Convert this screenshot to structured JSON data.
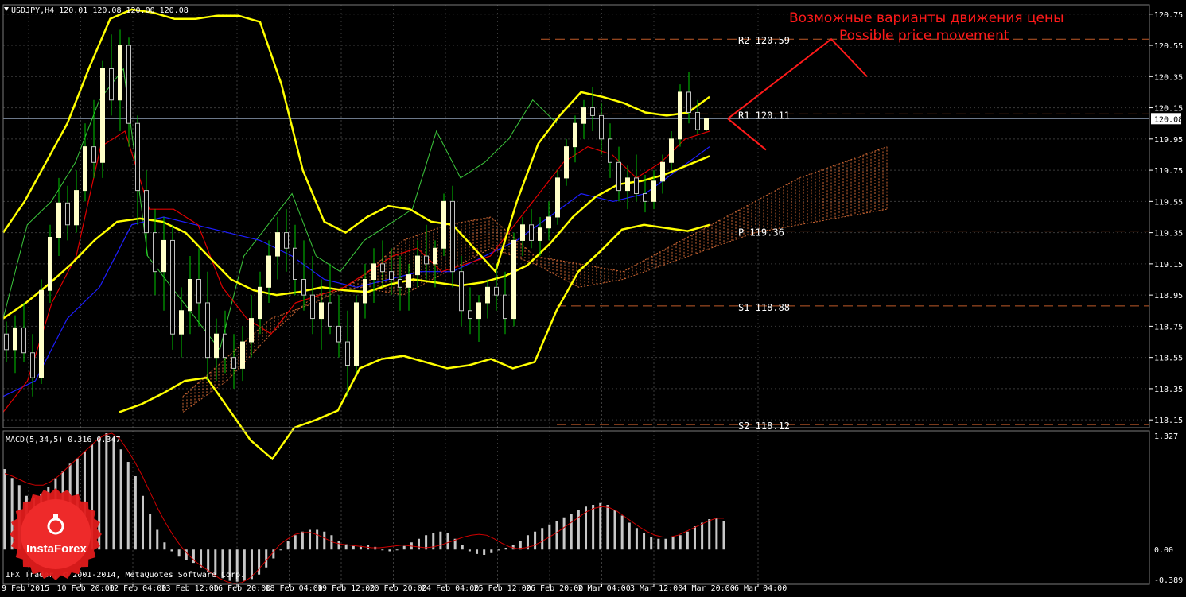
{
  "window": {
    "symbol_header": "USDJPY,H4  120.01 120.08 120.00 120.08",
    "copyright": "IFX Trader, © 2001-2014, MetaQuotes Software Corp."
  },
  "colors": {
    "background": "#000000",
    "grid": "#3a3a3a",
    "bollinger": "#ffff00",
    "candle_up": "#ffffc8",
    "candle_down": "#c0c0c0",
    "wick": "#00c800",
    "chikou": "#3cc83c",
    "tenkan": "#e00000",
    "kijun": "#1e1eff",
    "kumo": "#cc6633",
    "pivot": "#c05a28",
    "forecast": "#ff1a1a",
    "histogram": "#c8c8c8",
    "macd_signal": "#d00000",
    "axis_text": "#ffffff"
  },
  "annotation": {
    "title_ru": "Возможные варианты движения цены",
    "title_en": "Possible price movement"
  },
  "brand": {
    "name": "InstaForex"
  },
  "chart_data": [
    {
      "type": "candlestick",
      "symbol": "USDJPY",
      "timeframe": "H4",
      "header_ohlc": {
        "open": 120.01,
        "high": 120.08,
        "low": 120.0,
        "close": 120.08
      },
      "current_price": "120.08",
      "y_range": [
        118.1,
        120.81
      ],
      "y_tick_labels": [
        "120.75",
        "120.55",
        "120.35",
        "120.15",
        "119.95",
        "119.75",
        "119.55",
        "119.35",
        "119.15",
        "118.95",
        "118.75",
        "118.55",
        "118.35",
        "118.15"
      ],
      "x_tick_labels": [
        "9 Feb 2015",
        "10 Feb 20:00",
        "12 Feb 04:00",
        "13 Feb 12:00",
        "16 Feb 20:00",
        "18 Feb 04:00",
        "19 Feb 12:00",
        "20 Feb 20:00",
        "24 Feb 04:00",
        "25 Feb 12:00",
        "26 Feb 20:00",
        "2 Mar 04:00",
        "3 Mar 12:00",
        "4 Mar 20:00",
        "6 Mar 04:00"
      ],
      "pivot_levels": [
        {
          "name": "R2",
          "label": "R2 120.59",
          "value": 120.59
        },
        {
          "name": "R1",
          "label": "R1 120.11",
          "value": 120.11
        },
        {
          "name": "P",
          "label": "P 119.36",
          "value": 119.36
        },
        {
          "name": "S1",
          "label": "S1 118.88",
          "value": 118.88
        },
        {
          "name": "S2",
          "label": "S2 118.12",
          "value": 118.12
        }
      ],
      "candles": [
        [
          118.7,
          118.78,
          118.52,
          118.6
        ],
        [
          118.6,
          118.82,
          118.45,
          118.74
        ],
        [
          118.74,
          118.9,
          118.52,
          118.58
        ],
        [
          118.58,
          118.7,
          118.3,
          118.42
        ],
        [
          118.42,
          119.05,
          118.38,
          118.98
        ],
        [
          118.98,
          119.4,
          118.9,
          119.32
        ],
        [
          119.32,
          119.7,
          119.2,
          119.54
        ],
        [
          119.54,
          119.65,
          119.3,
          119.4
        ],
        [
          119.4,
          119.75,
          119.35,
          119.62
        ],
        [
          119.62,
          120.05,
          119.55,
          119.9
        ],
        [
          119.9,
          120.2,
          119.7,
          119.8
        ],
        [
          119.8,
          120.45,
          119.7,
          120.4
        ],
        [
          120.4,
          120.62,
          120.1,
          120.2
        ],
        [
          120.2,
          120.65,
          120.0,
          120.55
        ],
        [
          120.55,
          120.6,
          119.9,
          120.05
        ],
        [
          120.05,
          120.1,
          119.4,
          119.62
        ],
        [
          119.62,
          119.75,
          119.2,
          119.35
        ],
        [
          119.35,
          119.5,
          118.95,
          119.1
        ],
        [
          119.1,
          119.45,
          118.85,
          119.3
        ],
        [
          119.3,
          119.4,
          118.6,
          118.7
        ],
        [
          118.7,
          119.0,
          118.55,
          118.85
        ],
        [
          118.85,
          119.2,
          118.7,
          119.05
        ],
        [
          119.05,
          119.25,
          118.75,
          118.9
        ],
        [
          118.9,
          119.1,
          118.4,
          118.55
        ],
        [
          118.55,
          118.8,
          118.4,
          118.7
        ],
        [
          118.7,
          118.85,
          118.45,
          118.55
        ],
        [
          118.55,
          118.7,
          118.35,
          118.48
        ],
        [
          118.48,
          118.75,
          118.4,
          118.65
        ],
        [
          118.65,
          118.95,
          118.55,
          118.8
        ],
        [
          118.8,
          119.1,
          118.7,
          119.0
        ],
        [
          119.0,
          119.3,
          118.9,
          119.2
        ],
        [
          119.2,
          119.45,
          119.05,
          119.35
        ],
        [
          119.35,
          119.5,
          119.1,
          119.25
        ],
        [
          119.25,
          119.4,
          118.95,
          119.05
        ],
        [
          119.05,
          119.3,
          118.85,
          118.95
        ],
        [
          118.95,
          119.2,
          118.7,
          118.8
        ],
        [
          118.8,
          119.05,
          118.6,
          118.9
        ],
        [
          118.9,
          119.15,
          118.7,
          118.75
        ],
        [
          118.75,
          118.95,
          118.55,
          118.65
        ],
        [
          118.65,
          118.85,
          118.3,
          118.5
        ],
        [
          118.5,
          118.95,
          118.45,
          118.9
        ],
        [
          118.9,
          119.15,
          118.8,
          119.05
        ],
        [
          119.05,
          119.25,
          118.9,
          119.15
        ],
        [
          119.15,
          119.3,
          119.0,
          119.1
        ],
        [
          119.1,
          119.25,
          118.95,
          119.05
        ],
        [
          119.05,
          119.2,
          118.85,
          119.0
        ],
        [
          119.0,
          119.15,
          118.85,
          119.08
        ],
        [
          119.08,
          119.3,
          119.0,
          119.2
        ],
        [
          119.2,
          119.4,
          119.05,
          119.15
        ],
        [
          119.15,
          119.3,
          119.0,
          119.25
        ],
        [
          119.25,
          119.6,
          119.2,
          119.55
        ],
        [
          119.55,
          119.65,
          119.0,
          119.1
        ],
        [
          119.1,
          119.2,
          118.75,
          118.85
        ],
        [
          118.85,
          119.0,
          118.7,
          118.8
        ],
        [
          118.8,
          118.95,
          118.65,
          118.9
        ],
        [
          118.9,
          119.05,
          118.8,
          119.0
        ],
        [
          119.0,
          119.15,
          118.85,
          118.95
        ],
        [
          118.95,
          119.1,
          118.7,
          118.8
        ],
        [
          118.8,
          119.35,
          118.75,
          119.3
        ],
        [
          119.3,
          119.45,
          119.2,
          119.4
        ],
        [
          119.4,
          119.5,
          119.25,
          119.3
        ],
        [
          119.3,
          119.45,
          119.2,
          119.38
        ],
        [
          119.38,
          119.55,
          119.3,
          119.45
        ],
        [
          119.45,
          119.75,
          119.4,
          119.7
        ],
        [
          119.7,
          119.95,
          119.65,
          119.9
        ],
        [
          119.9,
          120.1,
          119.8,
          120.05
        ],
        [
          120.05,
          120.2,
          119.95,
          120.15
        ],
        [
          120.15,
          120.28,
          120.0,
          120.1
        ],
        [
          120.1,
          120.18,
          119.85,
          119.95
        ],
        [
          119.95,
          120.05,
          119.7,
          119.8
        ],
        [
          119.8,
          119.9,
          119.55,
          119.62
        ],
        [
          119.62,
          119.78,
          119.5,
          119.7
        ],
        [
          119.7,
          119.85,
          119.55,
          119.6
        ],
        [
          119.6,
          119.72,
          119.48,
          119.55
        ],
        [
          119.55,
          119.75,
          119.5,
          119.68
        ],
        [
          119.68,
          119.85,
          119.6,
          119.8
        ],
        [
          119.8,
          120.0,
          119.75,
          119.95
        ],
        [
          119.95,
          120.3,
          119.9,
          120.25
        ],
        [
          120.25,
          120.38,
          120.05,
          120.12
        ],
        [
          120.12,
          120.2,
          119.98,
          120.01
        ],
        [
          120.01,
          120.08,
          120.0,
          120.08
        ]
      ],
      "bollinger": {
        "upper": [
          119.35,
          119.55,
          119.8,
          120.05,
          120.4,
          120.72,
          120.78,
          120.76,
          120.72,
          120.72,
          120.74,
          120.74,
          120.7,
          120.3,
          119.75,
          119.42,
          119.35,
          119.45,
          119.52,
          119.5,
          119.42,
          119.4,
          119.25,
          119.1,
          119.55,
          119.92,
          120.1,
          120.25,
          120.22,
          120.18,
          120.12,
          120.1,
          120.12,
          120.22
        ],
        "middle": [
          118.8,
          118.9,
          119.02,
          119.15,
          119.3,
          119.42,
          119.44,
          119.42,
          119.35,
          119.2,
          119.05,
          118.98,
          118.95,
          118.97,
          119.0,
          118.98,
          118.97,
          119.02,
          119.05,
          119.03,
          119.01,
          119.03,
          119.07,
          119.14,
          119.28,
          119.45,
          119.58,
          119.66,
          119.68,
          119.72,
          119.78,
          119.84
        ],
        "lower": [
          118.2,
          118.25,
          118.32,
          118.4,
          118.42,
          118.22,
          118.02,
          117.9,
          118.1,
          118.15,
          118.21,
          118.48,
          118.54,
          118.56,
          118.52,
          118.48,
          118.5,
          118.54,
          118.48,
          118.52,
          118.85,
          119.1,
          119.23,
          119.37,
          119.4,
          119.38,
          119.36,
          119.4
        ]
      },
      "ichimoku": {
        "tenkan": [
          118.2,
          118.4,
          118.9,
          119.2,
          119.9,
          120.0,
          119.5,
          119.5,
          119.4,
          119.0,
          118.8,
          118.7,
          118.9,
          118.95,
          119.0,
          119.1,
          119.2,
          119.25,
          119.1,
          119.15,
          119.2,
          119.4,
          119.6,
          119.8,
          119.9,
          119.85,
          119.7,
          119.8,
          119.95,
          120.0
        ],
        "kijun": [
          118.3,
          118.4,
          118.8,
          119.0,
          119.4,
          119.45,
          119.4,
          119.35,
          119.3,
          119.2,
          119.05,
          119.0,
          119.05,
          119.1,
          119.1,
          119.2,
          119.3,
          119.45,
          119.6,
          119.55,
          119.6,
          119.75,
          119.9
        ],
        "chikou": [
          118.8,
          119.4,
          119.55,
          119.8,
          120.2,
          120.4,
          119.2,
          119.0,
          118.8,
          118.6,
          119.2,
          119.4,
          119.6,
          119.2,
          119.1,
          119.3,
          119.4,
          119.5,
          120.0,
          119.7,
          119.8,
          119.95,
          120.2,
          120.05
        ],
        "kumo_span_a": [
          118.3,
          118.55,
          118.8,
          118.9,
          119.05,
          119.3,
          119.4,
          119.45,
          119.2,
          119.15,
          119.1,
          119.25,
          119.4,
          119.55,
          119.7,
          119.8,
          119.9
        ],
        "kumo_span_b": [
          118.2,
          118.4,
          118.7,
          118.95,
          119.0,
          118.95,
          119.1,
          119.25,
          119.15,
          119.0,
          119.05,
          119.15,
          119.25,
          119.35,
          119.4,
          119.45,
          119.5
        ]
      },
      "forecast_path": [
        {
          "label": "up scenario",
          "points": [
            [
              120.08
            ],
            [
              120.59
            ],
            [
              120.35
            ]
          ]
        },
        {
          "label": "down scenario",
          "points": [
            [
              120.08
            ],
            [
              119.88
            ]
          ]
        }
      ]
    },
    {
      "type": "bar",
      "indicator": "MACD",
      "label": "MACD(5,34,5) 0.316 0.347",
      "params": [
        5,
        34,
        5
      ],
      "macd_value": 0.316,
      "signal_value": 0.347,
      "y_range": [
        -0.389,
        1.327
      ],
      "y_tick_labels": [
        "1.327",
        "0.00",
        "-0.389"
      ],
      "histogram": [
        0.9,
        0.8,
        0.72,
        0.6,
        0.58,
        0.62,
        0.7,
        0.8,
        0.88,
        0.96,
        1.02,
        1.1,
        1.18,
        1.25,
        1.3,
        1.25,
        1.12,
        0.98,
        0.82,
        0.6,
        0.4,
        0.22,
        0.08,
        -0.02,
        -0.08,
        -0.12,
        -0.15,
        -0.2,
        -0.25,
        -0.28,
        -0.32,
        -0.35,
        -0.36,
        -0.35,
        -0.33,
        -0.28,
        -0.2,
        -0.1,
        0.0,
        0.1,
        0.16,
        0.2,
        0.22,
        0.22,
        0.2,
        0.16,
        0.1,
        0.06,
        0.04,
        0.04,
        0.05,
        0.03,
        0.0,
        -0.02,
        0.0,
        0.04,
        0.08,
        0.12,
        0.16,
        0.18,
        0.2,
        0.18,
        0.12,
        0.05,
        -0.02,
        -0.05,
        -0.06,
        -0.04,
        -0.01,
        0.02,
        0.05,
        0.1,
        0.16,
        0.2,
        0.24,
        0.28,
        0.32,
        0.36,
        0.4,
        0.44,
        0.48,
        0.5,
        0.52,
        0.5,
        0.44,
        0.38,
        0.3,
        0.24,
        0.18,
        0.14,
        0.12,
        0.12,
        0.14,
        0.16,
        0.2,
        0.26,
        0.3,
        0.34,
        0.35,
        0.32
      ],
      "signal": [
        0.85,
        0.82,
        0.78,
        0.74,
        0.72,
        0.72,
        0.76,
        0.82,
        0.9,
        0.98,
        1.06,
        1.14,
        1.22,
        1.28,
        1.3,
        1.24,
        1.12,
        0.98,
        0.82,
        0.64,
        0.46,
        0.3,
        0.16,
        0.04,
        -0.06,
        -0.14,
        -0.2,
        -0.26,
        -0.32,
        -0.36,
        -0.38,
        -0.37,
        -0.32,
        -0.24,
        -0.14,
        -0.04,
        0.06,
        0.12,
        0.17,
        0.19,
        0.19,
        0.16,
        0.12,
        0.08,
        0.06,
        0.05,
        0.04,
        0.03,
        0.02,
        0.02,
        0.03,
        0.04,
        0.05,
        0.04,
        0.03,
        0.02,
        0.03,
        0.05,
        0.08,
        0.11,
        0.14,
        0.16,
        0.17,
        0.16,
        0.12,
        0.07,
        0.03,
        0.01,
        0.02,
        0.04,
        0.08,
        0.13,
        0.18,
        0.24,
        0.3,
        0.36,
        0.42,
        0.46,
        0.48,
        0.47,
        0.43,
        0.37,
        0.31,
        0.25,
        0.2,
        0.16,
        0.14,
        0.14,
        0.16,
        0.2,
        0.24,
        0.28,
        0.32,
        0.35,
        0.35
      ]
    }
  ]
}
